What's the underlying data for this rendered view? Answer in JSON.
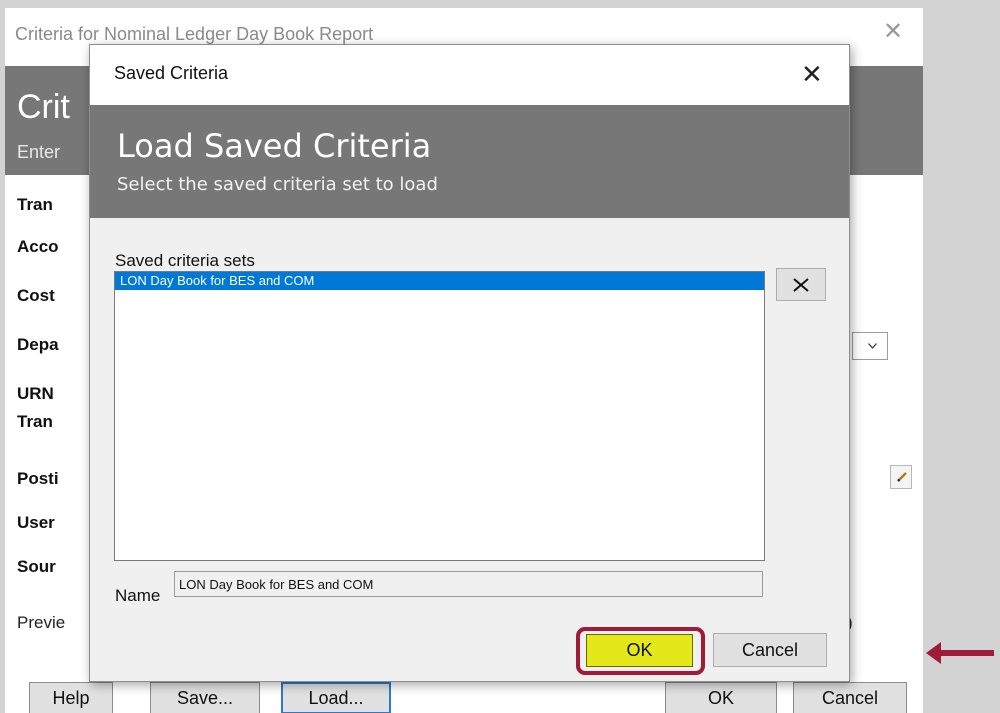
{
  "background_window": {
    "title": "Criteria for Nominal Ledger Day Book Report",
    "banner_title": "Crit",
    "banner_subtitle": "Enter",
    "field_labels": [
      "Tran",
      "Acco",
      "Cost",
      "Depa",
      "URN",
      "Tran",
      "Posti",
      "User",
      "Sour"
    ],
    "preview_label": "Previe",
    "preview_suffix": ")",
    "buttons": {
      "help": "Help",
      "save": "Save...",
      "load": "Load...",
      "ok": "OK",
      "cancel": "Cancel"
    }
  },
  "dialog": {
    "title": "Saved Criteria",
    "heading": "Load Saved Criteria",
    "subheading": "Select the saved criteria set to load",
    "sets_label": "Saved criteria sets",
    "sets": [
      {
        "label": "LON Day Book for BES and COM",
        "selected": true
      }
    ],
    "name_label": "Name",
    "name_value": "LON Day Book for BES and COM",
    "ok_label": "OK",
    "cancel_label": "Cancel"
  },
  "colors": {
    "banner": "#777777",
    "selection": "#0078d7",
    "ok_highlight_fill": "#e4e81a",
    "callout": "#a01a3a"
  },
  "icons": {
    "dialog_close": "close-icon",
    "delete": "x-icon",
    "dropdown": "chevron-down-icon",
    "edit": "pencil-icon",
    "callout": "arrow-left-icon"
  }
}
